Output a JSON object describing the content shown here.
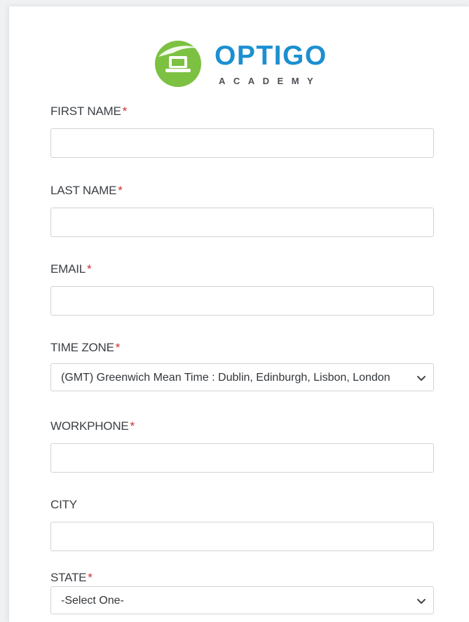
{
  "logo": {
    "title": "OPTIGO",
    "subtitle": "ACADEMY",
    "colors": {
      "green": "#7cc142",
      "blue": "#1c8fd0",
      "gray": "#4a4f55"
    }
  },
  "form": {
    "required_marker": "*",
    "fields": [
      {
        "label": "FIRST NAME",
        "required": true,
        "type": "text",
        "value": ""
      },
      {
        "label": "LAST NAME",
        "required": true,
        "type": "text",
        "value": ""
      },
      {
        "label": "EMAIL",
        "required": true,
        "type": "text",
        "value": ""
      },
      {
        "label": "TIME ZONE",
        "required": true,
        "type": "select",
        "value": "(GMT) Greenwich Mean Time : Dublin, Edinburgh, Lisbon, London"
      },
      {
        "label": "WORKPHONE",
        "required": true,
        "type": "text",
        "value": ""
      },
      {
        "label": "CITY",
        "required": false,
        "type": "text",
        "value": ""
      },
      {
        "label": "STATE",
        "required": true,
        "type": "select",
        "value": "-Select One-"
      }
    ]
  },
  "colors": {
    "required": "#d02b2b",
    "border": "#cfd3d8",
    "label": "#3b3f44"
  }
}
